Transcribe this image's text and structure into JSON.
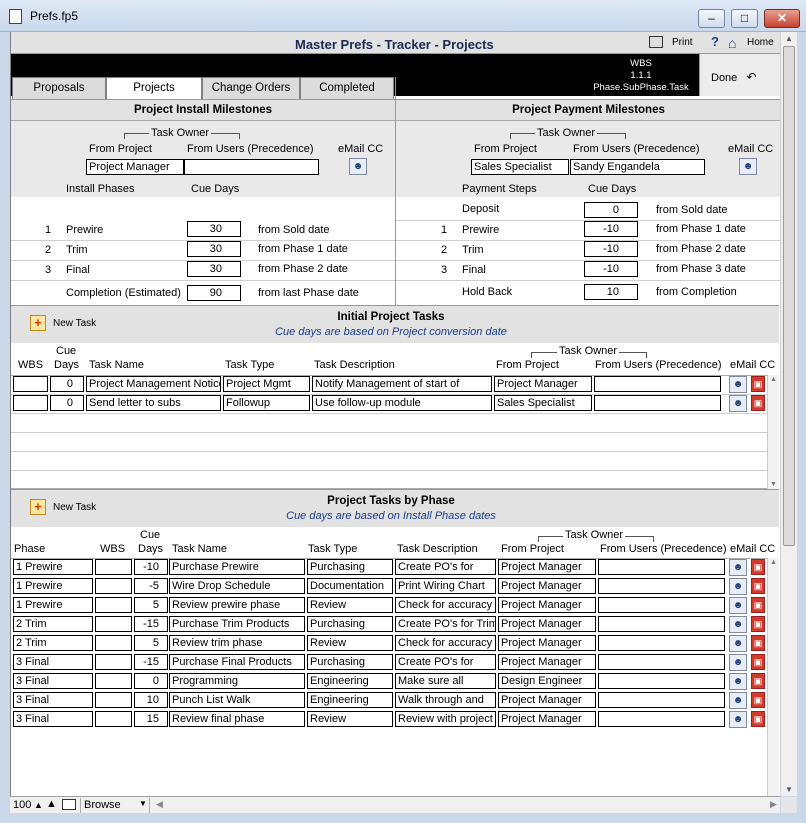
{
  "window": {
    "title": "Prefs.fp5"
  },
  "header": {
    "title": "Master Prefs - Tracker - Projects",
    "print": "Print",
    "help": "?",
    "home": "Home"
  },
  "wbs_box": {
    "l1": "WBS",
    "l2": "1.1.1",
    "l3": "Phase.SubPhase.Task"
  },
  "done": "Done",
  "tabs": [
    "Proposals",
    "Projects",
    "Change Orders",
    "Completed"
  ],
  "install": {
    "title": "Project Install Milestones",
    "task_owner": "Task Owner",
    "from_project_label": "From Project",
    "from_users_label": "From Users (Precedence)",
    "email_cc": "eMail CC",
    "from_project": "Project Manager",
    "from_users": "",
    "col1": "Install Phases",
    "col2": "Cue Days",
    "rows": [
      {
        "n": "1",
        "name": "Prewire",
        "days": "30",
        "from": "from Sold date"
      },
      {
        "n": "2",
        "name": "Trim",
        "days": "30",
        "from": "from Phase 1 date"
      },
      {
        "n": "3",
        "name": "Final",
        "days": "30",
        "from": "from Phase 2 date"
      }
    ],
    "completion": {
      "name": "Completion (Estimated)",
      "days": "90",
      "from": "from last Phase date"
    }
  },
  "payment": {
    "title": "Project Payment Milestones",
    "task_owner": "Task Owner",
    "from_project_label": "From Project",
    "from_users_label": "From Users (Precedence)",
    "email_cc": "eMail CC",
    "from_project": "Sales Specialist",
    "from_users": "Sandy Engandela",
    "col1": "Payment Steps",
    "col2": "Cue Days",
    "deposit": {
      "name": "Deposit",
      "days": "0",
      "from": "from Sold date"
    },
    "rows": [
      {
        "n": "1",
        "name": "Prewire",
        "days": "-10",
        "from": "from Phase 1 date"
      },
      {
        "n": "2",
        "name": "Trim",
        "days": "-10",
        "from": "from Phase 2 date"
      },
      {
        "n": "3",
        "name": "Final",
        "days": "-10",
        "from": "from Phase 3 date"
      }
    ],
    "holdback": {
      "name": "Hold Back",
      "days": "10",
      "from": "from Completion"
    }
  },
  "initial": {
    "new_task": "New Task",
    "title": "Initial Project Tasks",
    "subtitle": "Cue days are based on Project conversion date",
    "headers": {
      "wbs": "WBS",
      "cue1": "Cue",
      "cue2": "Days",
      "name": "Task Name",
      "type": "Task Type",
      "desc": "Task Description",
      "owner": "Task Owner",
      "from_project": "From Project",
      "from_users": "From Users (Precedence)",
      "email": "eMail CC"
    },
    "rows": [
      {
        "wbs": "",
        "days": "0",
        "name": "Project Management Notice",
        "type": "Project Mgmt",
        "desc": "Notify Management of start of",
        "project": "Project Manager",
        "users": ""
      },
      {
        "wbs": "",
        "days": "0",
        "name": "Send letter to subs",
        "type": "Followup",
        "desc": "Use follow-up module",
        "project": "Sales Specialist",
        "users": ""
      }
    ]
  },
  "byphase": {
    "new_task": "New Task",
    "title": "Project Tasks by Phase",
    "subtitle": "Cue days are based on Install Phase dates",
    "headers": {
      "phase": "Phase",
      "wbs": "WBS",
      "cue1": "Cue",
      "cue2": "Days",
      "name": "Task Name",
      "type": "Task Type",
      "desc": "Task Description",
      "owner": "Task Owner",
      "from_project": "From Project",
      "from_users": "From Users (Precedence)",
      "email": "eMail CC"
    },
    "rows": [
      {
        "phase": "1 Prewire",
        "wbs": "",
        "days": "-10",
        "name": "Purchase Prewire",
        "type": "Purchasing",
        "desc": "Create PO's for",
        "project": "Project Manager",
        "users": ""
      },
      {
        "phase": "1 Prewire",
        "wbs": "",
        "days": "-5",
        "name": "Wire Drop Schedule",
        "type": "Documentation",
        "desc": "Print Wiring Chart",
        "project": "Project Manager",
        "users": ""
      },
      {
        "phase": "1 Prewire",
        "wbs": "",
        "days": "5",
        "name": "Review prewire phase",
        "type": "Review",
        "desc": "Check for accuracy",
        "project": "Project Manager",
        "users": ""
      },
      {
        "phase": "2 Trim",
        "wbs": "",
        "days": "-15",
        "name": "Purchase Trim Products",
        "type": "Purchasing",
        "desc": "Create PO's for Trim",
        "project": "Project Manager",
        "users": ""
      },
      {
        "phase": "2 Trim",
        "wbs": "",
        "days": "5",
        "name": "Review trim phase",
        "type": "Review",
        "desc": "Check for accuracy",
        "project": "Project Manager",
        "users": ""
      },
      {
        "phase": "3 Final",
        "wbs": "",
        "days": "-15",
        "name": "Purchase Final Products",
        "type": "Purchasing",
        "desc": "Create PO's for",
        "project": "Project Manager",
        "users": ""
      },
      {
        "phase": "3 Final",
        "wbs": "",
        "days": "0",
        "name": "Programming",
        "type": "Engineering",
        "desc": "Make sure all",
        "project": "Design Engineer",
        "users": ""
      },
      {
        "phase": "3 Final",
        "wbs": "",
        "days": "10",
        "name": "Punch List Walk",
        "type": "Engineering",
        "desc": "Walk through and",
        "project": "Project Manager",
        "users": ""
      },
      {
        "phase": "3 Final",
        "wbs": "",
        "days": "15",
        "name": "Review final phase",
        "type": "Review",
        "desc": "Review with project",
        "project": "Project Manager",
        "users": ""
      }
    ]
  },
  "statusbar": {
    "zoom": "100",
    "mode": "Browse"
  }
}
